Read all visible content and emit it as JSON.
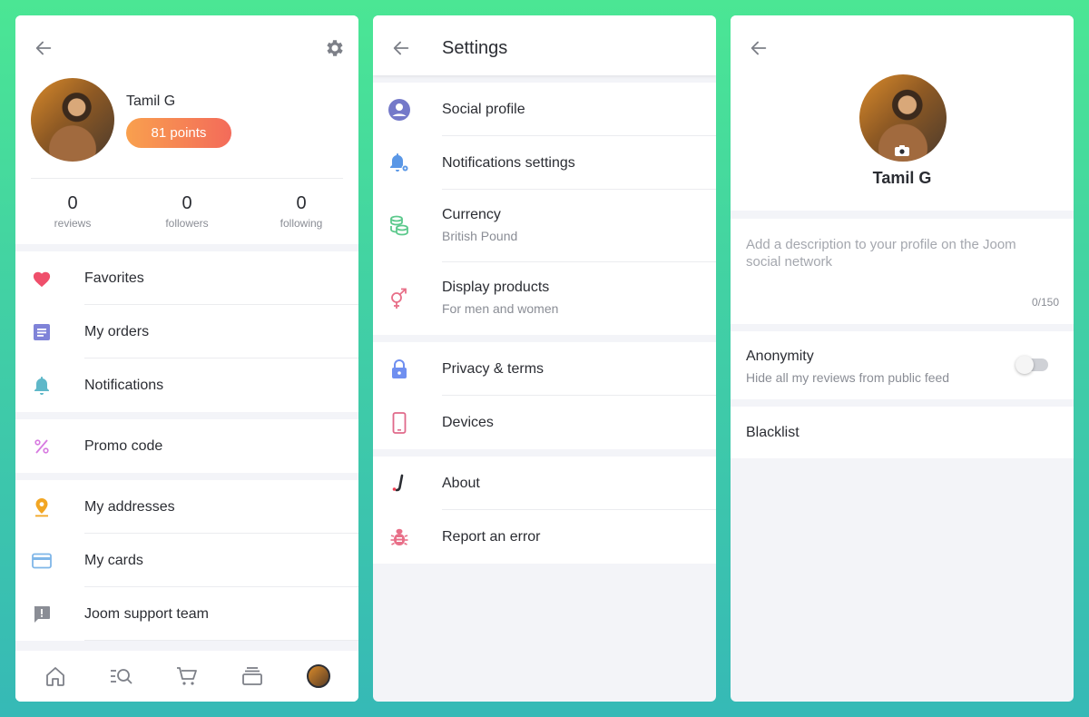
{
  "profile": {
    "name": "Tamil G",
    "points": "81 points",
    "stats": [
      {
        "value": "0",
        "label": "reviews"
      },
      {
        "value": "0",
        "label": "followers"
      },
      {
        "value": "0",
        "label": "following"
      }
    ],
    "menu": {
      "favorites": {
        "label": "Favorites",
        "icon": "heart-icon",
        "color": "#ef4f6b"
      },
      "orders": {
        "label": "My orders",
        "icon": "orders-icon",
        "color": "#7f83d8"
      },
      "notifications": {
        "label": "Notifications",
        "icon": "bell-icon",
        "color": "#5fb8c9"
      },
      "promo": {
        "label": "Promo code",
        "icon": "percent-icon",
        "color": "#d77ae0"
      },
      "addresses": {
        "label": "My addresses",
        "icon": "location-pin-icon",
        "color": "#f2a623"
      },
      "cards": {
        "label": "My cards",
        "icon": "credit-card-icon",
        "color": "#7fb6e8"
      },
      "support": {
        "label": "Joom support team",
        "icon": "chat-alert-icon",
        "color": "#8a8d95"
      }
    },
    "tabbar": [
      "home-icon",
      "search-list-icon",
      "cart-icon",
      "stack-icon",
      "profile-avatar"
    ]
  },
  "settings": {
    "title": "Settings",
    "items": {
      "social": {
        "label": "Social profile",
        "icon": "user-circle-icon",
        "color": "#7479c9"
      },
      "notif": {
        "label": "Notifications settings",
        "icon": "bell-gear-icon",
        "color": "#5a97e6"
      },
      "currency": {
        "label": "Currency",
        "sub": "British Pound",
        "icon": "coins-icon",
        "color": "#5cc98c"
      },
      "display": {
        "label": "Display products",
        "sub": "For men and women",
        "icon": "gender-icon",
        "color": "#e86f88"
      },
      "privacy": {
        "label": "Privacy & terms",
        "icon": "lock-icon",
        "color": "#6f8ff0"
      },
      "devices": {
        "label": "Devices",
        "icon": "phone-icon",
        "color": "#e0698a"
      },
      "about": {
        "label": "About",
        "icon": "joom-logo-icon",
        "color": "#2b2d33"
      },
      "report": {
        "label": "Report an error",
        "icon": "bug-icon",
        "color": "#e86f88"
      }
    }
  },
  "social_profile": {
    "name": "Tamil G",
    "description_placeholder": "Add a description to your profile on the Joom social network",
    "counter": "0/150",
    "anonymity": {
      "title": "Anonymity",
      "subtitle": "Hide all my reviews from public feed",
      "enabled": false
    },
    "blacklist": "Blacklist"
  }
}
